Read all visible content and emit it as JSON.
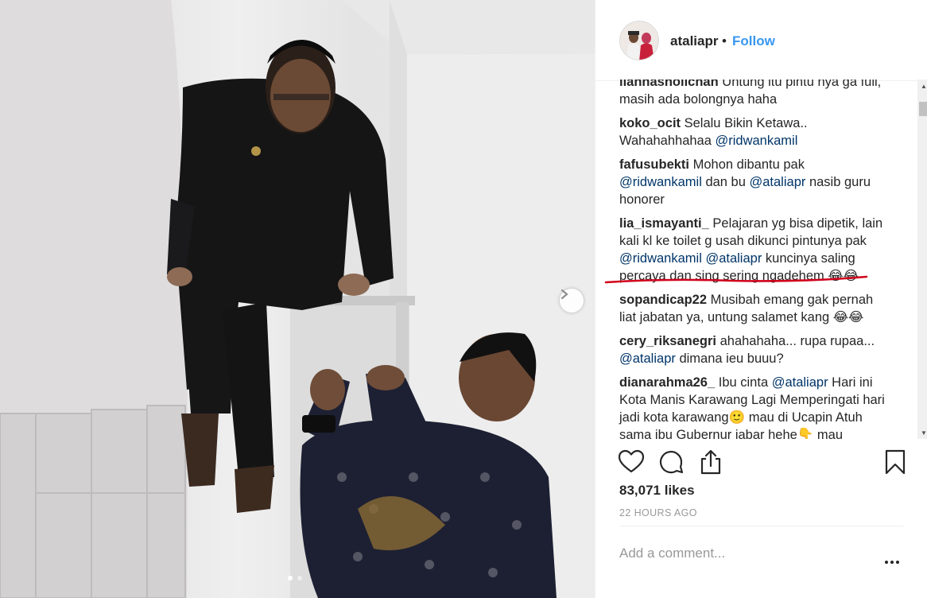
{
  "post": {
    "username": "ataliapr",
    "separator": "•",
    "follow_label": "Follow",
    "likes": "83,071 likes",
    "timestamp": "22 HOURS AGO",
    "add_comment_placeholder": "Add a comment...",
    "carousel": {
      "count": 2,
      "active_index": 0
    }
  },
  "comments": [
    {
      "user": "liannasholichan",
      "parts": [
        {
          "t": " Untung itu pintu nya ga full, masih ada bolongnya haha"
        }
      ]
    },
    {
      "user": "koko_ocit",
      "parts": [
        {
          "t": " Selalu Bikin Ketawa.. Wahahahhahaa "
        },
        {
          "m": "@ridwankamil"
        }
      ]
    },
    {
      "user": "fafusubekti",
      "parts": [
        {
          "t": " Mohon dibantu pak "
        },
        {
          "m": "@ridwankamil"
        },
        {
          "t": " dan bu "
        },
        {
          "m": "@ataliapr"
        },
        {
          "t": " nasib guru honorer"
        }
      ]
    },
    {
      "user": "lia_ismayanti_",
      "parts": [
        {
          "t": " Pelajaran yg bisa dipetik, lain kali kl ke toilet g usah dikunci pintunya pak "
        },
        {
          "m": "@ridwankamil"
        },
        {
          "t": " "
        },
        {
          "m": "@ataliapr"
        },
        {
          "t": " kuncinya saling percaya dan sing sering ngadehem 😂😂"
        }
      ]
    },
    {
      "user": "sopandicap22",
      "parts": [
        {
          "t": " Musibah emang gak pernah liat jabatan ya, untung salamet kang 😂😂"
        }
      ]
    },
    {
      "user": "cery_riksanegri",
      "parts": [
        {
          "t": " ahahahaha... rupa rupaa... "
        },
        {
          "m": "@ataliapr"
        },
        {
          "t": " dimana ieu buuu?"
        }
      ]
    },
    {
      "user": "dianarahma26_",
      "parts": [
        {
          "t": " Ibu cinta "
        },
        {
          "m": "@ataliapr"
        },
        {
          "t": " Hari ini Kota Manis Karawang Lagi Memperingati hari jadi kota karawang🙂 mau di Ucapin Atuh sama ibu Gubernur jabar hehe👇 mau"
        }
      ]
    }
  ],
  "icons": {
    "like": "heart-icon",
    "comment": "comment-icon",
    "share": "share-icon",
    "save": "bookmark-icon",
    "next": "chevron-right-icon",
    "more": "more-options-icon"
  },
  "colors": {
    "follow": "#3897f0",
    "mention": "#003569",
    "muted": "#999999",
    "annotation": "#d0021b"
  }
}
